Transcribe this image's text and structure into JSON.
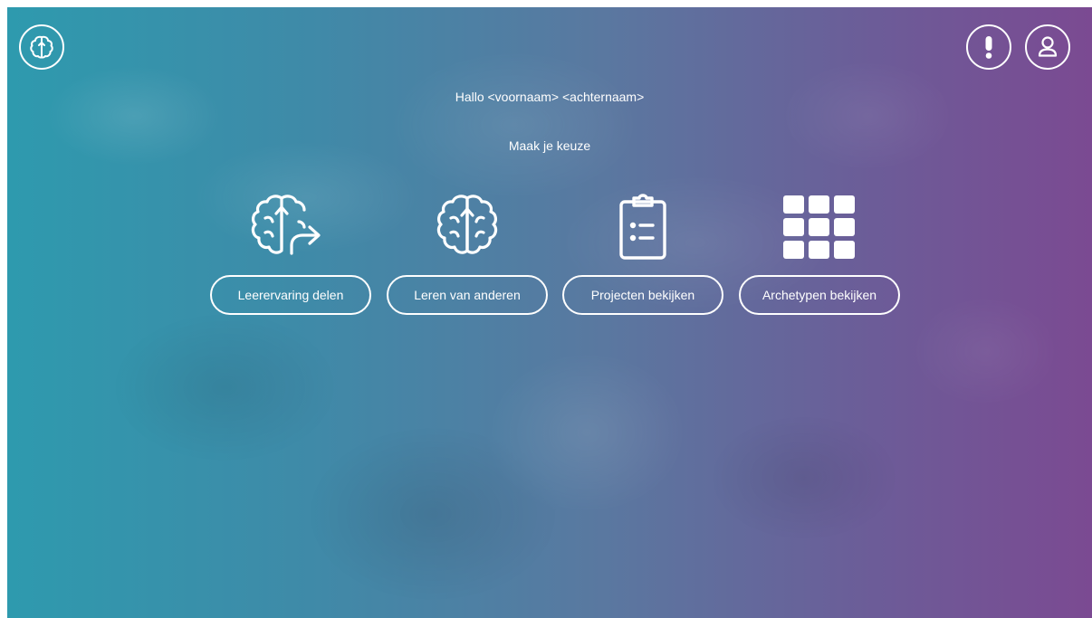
{
  "header": {
    "logo_icon": "brain-logo-icon",
    "alert_icon": "exclamation-icon",
    "profile_icon": "user-icon"
  },
  "main": {
    "greeting": "Hallo <voornaam> <achternaam>",
    "prompt": "Maak je keuze",
    "options": [
      {
        "label": "Leerervaring delen",
        "icon": "brain-share-icon"
      },
      {
        "label": "Leren van anderen",
        "icon": "brain-icon"
      },
      {
        "label": "Projecten bekijken",
        "icon": "clipboard-list-icon"
      },
      {
        "label": "Archetypen bekijken",
        "icon": "grid-icon"
      }
    ]
  },
  "colors": {
    "gradient_left": "#2e9aae",
    "gradient_right": "#7b4a92",
    "foreground": "#ffffff"
  }
}
